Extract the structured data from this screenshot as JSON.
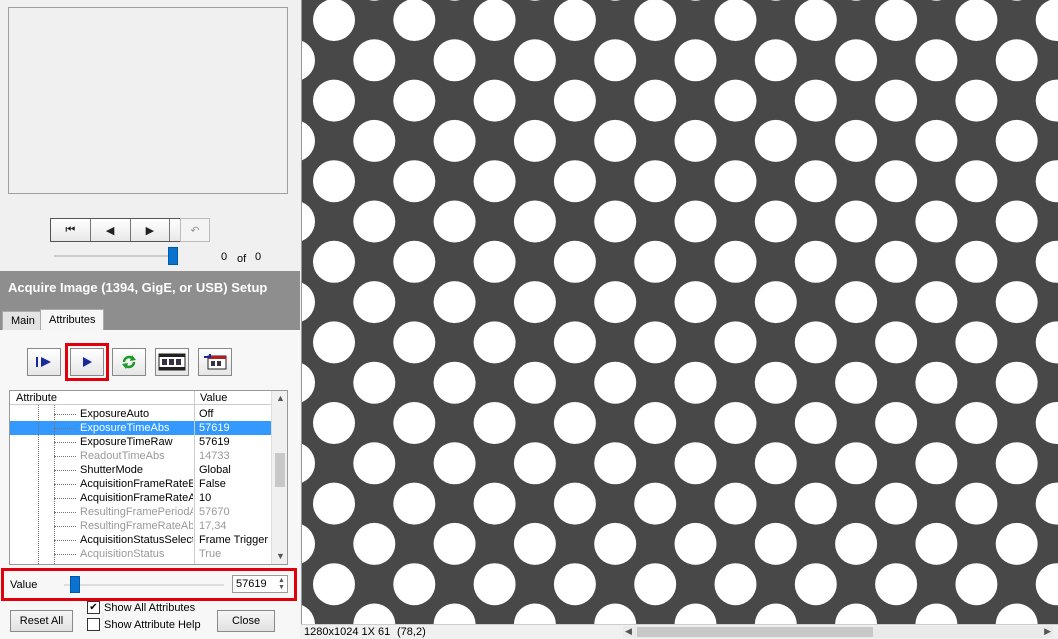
{
  "preview": {
    "counter_current": "0",
    "counter_of": "of",
    "counter_total": "0",
    "playback_fraction": 1.0
  },
  "setup": {
    "title": "Acquire Image (1394, GigE, or USB) Setup",
    "tabs": [
      {
        "label": "Main"
      },
      {
        "label": "Attributes"
      }
    ]
  },
  "attribute_grid": {
    "header_attribute": "Attribute",
    "header_value": "Value",
    "rows": [
      {
        "name": "ExposureAuto",
        "value": "Off",
        "state": "normal"
      },
      {
        "name": "ExposureTimeAbs",
        "value": "57619",
        "state": "selected"
      },
      {
        "name": "ExposureTimeRaw",
        "value": "57619",
        "state": "normal"
      },
      {
        "name": "ReadoutTimeAbs",
        "value": "14733",
        "state": "disabled"
      },
      {
        "name": "ShutterMode",
        "value": "Global",
        "state": "normal"
      },
      {
        "name": "AcquisitionFrameRateEn",
        "value": "False",
        "state": "normal"
      },
      {
        "name": "AcquisitionFrameRateA",
        "value": "10",
        "state": "normal"
      },
      {
        "name": "ResultingFramePeriodA",
        "value": "57670",
        "state": "disabled"
      },
      {
        "name": "ResultingFrameRateAbs",
        "value": "17,34",
        "state": "disabled"
      },
      {
        "name": "AcquisitionStatusSelect",
        "value": "Frame Trigger W",
        "state": "normal"
      },
      {
        "name": "AcquisitionStatus",
        "value": "True",
        "state": "disabled"
      }
    ]
  },
  "value_control": {
    "label": "Value",
    "value": "57619",
    "slider_fraction": 0.05
  },
  "footer": {
    "reset_all": "Reset All",
    "show_all_attributes": "Show All Attributes",
    "show_all_checked": true,
    "show_attribute_help": "Show Attribute Help",
    "show_help_checked": false,
    "close": "Close"
  },
  "status_bar": {
    "info": "1280x1024 1X 61",
    "coords": "(78,2)"
  },
  "icons": {
    "nav": [
      "first-frame-icon",
      "prev-frame-icon",
      "next-frame-icon",
      "last-frame-icon",
      "undo-icon"
    ],
    "toolbar": [
      "single-snap-icon",
      "live-play-icon",
      "refresh-icon",
      "film-strip-icon",
      "export-icon"
    ]
  },
  "colors": {
    "highlight": "#e0000b",
    "selection": "#3399ff",
    "header_bg": "#8e8e8e",
    "image_bg": "#484848"
  }
}
